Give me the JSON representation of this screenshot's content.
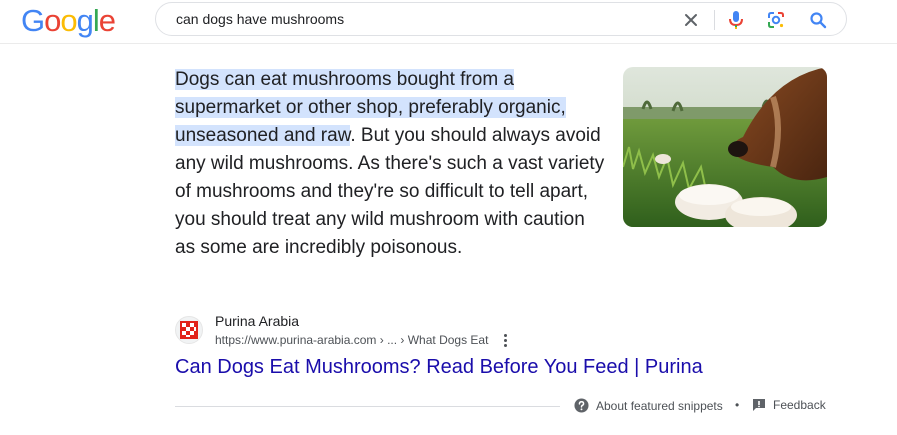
{
  "logo": {
    "letters": [
      "G",
      "o",
      "o",
      "g",
      "l",
      "e"
    ],
    "colors": [
      "#4285f4",
      "#ea4335",
      "#fbbc05",
      "#4285f4",
      "#34a853",
      "#ea4335"
    ]
  },
  "search": {
    "query": "can dogs have mushrooms",
    "icons": [
      "close-icon",
      "microphone-icon",
      "lens-icon",
      "search-icon"
    ]
  },
  "snippet": {
    "highlight": "Dogs can eat mushrooms bought from a supermarket or other shop, preferably organic, unseasoned and raw",
    "body": ". But you should always avoid any wild mushrooms. As there's such a vast variety of mushrooms and they're so difficult to tell apart, you should treat any wild mushroom with caution as some are incredibly poisonous.",
    "image_icon": "dog-sniffing-mushrooms-image"
  },
  "source": {
    "site_name": "Purina Arabia",
    "url": "https://www.purina-arabia.com › ... › What Dogs Eat",
    "title": "Can Dogs Eat Mushrooms? Read Before You Feed | Purina",
    "favicon_icon": "purina-checkerboard-icon",
    "favicon_color": "#e2231a"
  },
  "footer": {
    "about_label": "About featured snippets",
    "separator": "•",
    "feedback_label": "Feedback"
  },
  "colors": {
    "link": "#1a0dab",
    "highlight": "#d3e3fd",
    "text": "#202124",
    "secondary": "#4d5156"
  }
}
